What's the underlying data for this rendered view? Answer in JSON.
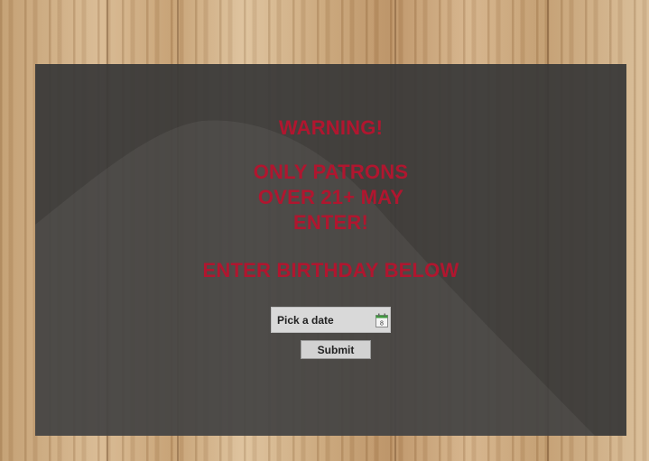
{
  "warning": {
    "title": "WARNING!",
    "lines": [
      "ONLY PATRONS",
      "OVER 21+ MAY",
      "ENTER!"
    ],
    "instruction": "ENTER BIRTHDAY BELOW"
  },
  "date_picker": {
    "placeholder": "Pick a date",
    "icon": "calendar-icon",
    "icon_day": "8"
  },
  "form": {
    "submit_label": "Submit"
  },
  "colors": {
    "warning_text": "#b0162f",
    "panel": "#383838",
    "wood_background": "#c9a77e"
  }
}
